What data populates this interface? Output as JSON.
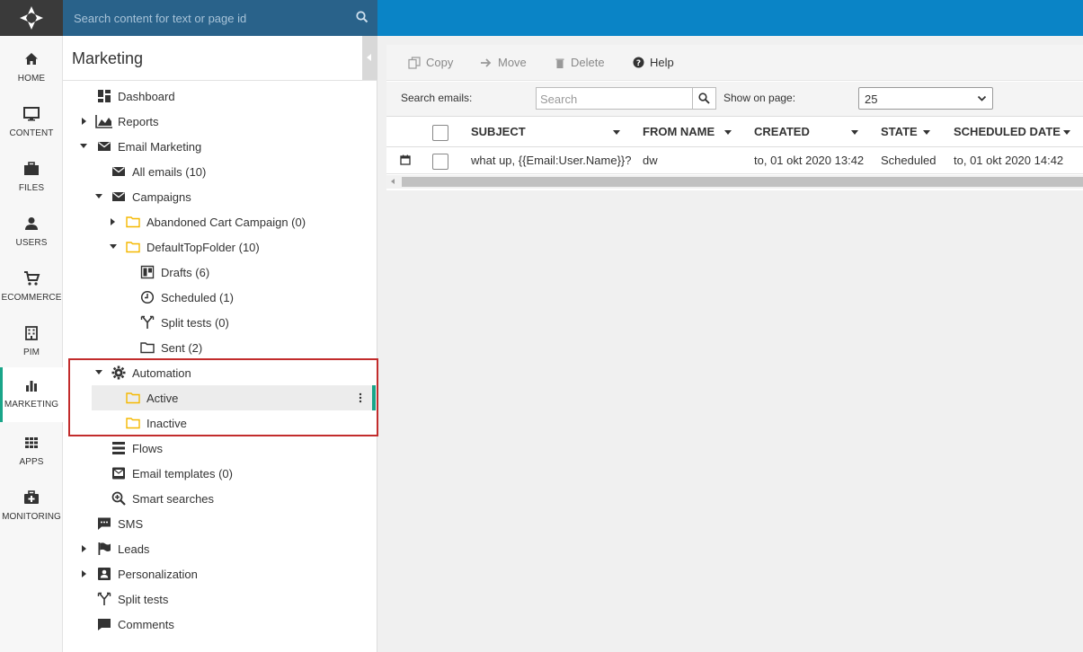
{
  "search": {
    "placeholder": "Search content for text or page id"
  },
  "leftnav": [
    {
      "label": "HOME",
      "icon": "home-icon"
    },
    {
      "label": "CONTENT",
      "icon": "monitor-icon"
    },
    {
      "label": "FILES",
      "icon": "briefcase-icon"
    },
    {
      "label": "USERS",
      "icon": "user-icon"
    },
    {
      "label": "ECOMMERCE",
      "icon": "cart-icon"
    },
    {
      "label": "PIM",
      "icon": "building-icon"
    },
    {
      "label": "MARKETING",
      "icon": "bar-chart-icon",
      "active": true
    },
    {
      "label": "APPS",
      "icon": "grid-icon"
    },
    {
      "label": "MONITORING",
      "icon": "medkit-icon"
    }
  ],
  "tree": {
    "title": "Marketing",
    "items": [
      {
        "label": "Dashboard",
        "icon": "dashboard-icon"
      },
      {
        "label": "Reports",
        "icon": "area-chart-icon"
      },
      {
        "label": "Email Marketing",
        "icon": "envelope-icon"
      },
      {
        "label": "All emails (10)",
        "icon": "envelope-icon"
      },
      {
        "label": "Campaigns",
        "icon": "envelope-icon"
      },
      {
        "label": "Abandoned Cart Campaign (0)",
        "icon": "folder-icon"
      },
      {
        "label": "DefaultTopFolder (10)",
        "icon": "folder-icon"
      },
      {
        "label": "Drafts (6)",
        "icon": "drafts-icon"
      },
      {
        "label": "Scheduled (1)",
        "icon": "clock-icon"
      },
      {
        "label": "Split tests (0)",
        "icon": "split-icon"
      },
      {
        "label": "Sent (2)",
        "icon": "folder-outline-icon"
      },
      {
        "label": "Automation",
        "icon": "gear-icon"
      },
      {
        "label": "Active",
        "icon": "folder-icon"
      },
      {
        "label": "Inactive",
        "icon": "folder-icon"
      },
      {
        "label": "Flows",
        "icon": "flows-icon"
      },
      {
        "label": "Email templates (0)",
        "icon": "email-template-icon"
      },
      {
        "label": "Smart searches",
        "icon": "search-plus-icon"
      },
      {
        "label": "SMS",
        "icon": "sms-icon"
      },
      {
        "label": "Leads",
        "icon": "flag-icon"
      },
      {
        "label": "Personalization",
        "icon": "contact-card-icon"
      },
      {
        "label": "Split tests",
        "icon": "split-icon"
      },
      {
        "label": "Comments",
        "icon": "comment-icon"
      }
    ]
  },
  "toolbar": {
    "copy": "Copy",
    "move": "Move",
    "delete": "Delete",
    "help": "Help"
  },
  "filters": {
    "search_label": "Search emails:",
    "search_placeholder": "Search",
    "show_label": "Show on page:",
    "show_value": "25"
  },
  "table": {
    "columns": [
      "SUBJECT",
      "FROM NAME",
      "CREATED",
      "STATE",
      "SCHEDULED DATE"
    ],
    "rows": [
      {
        "subject": "what up, {{Email:User.Name}}?",
        "from_name": "dw",
        "created": "to, 01 okt 2020 13:42",
        "state": "Scheduled",
        "scheduled_date": "to, 01 okt 2020 14:42"
      }
    ]
  },
  "colors": {
    "topbar": "#0a84c6",
    "accent": "#1aa589",
    "folder": "#f5b800",
    "highlight_border": "#c22c2c"
  }
}
